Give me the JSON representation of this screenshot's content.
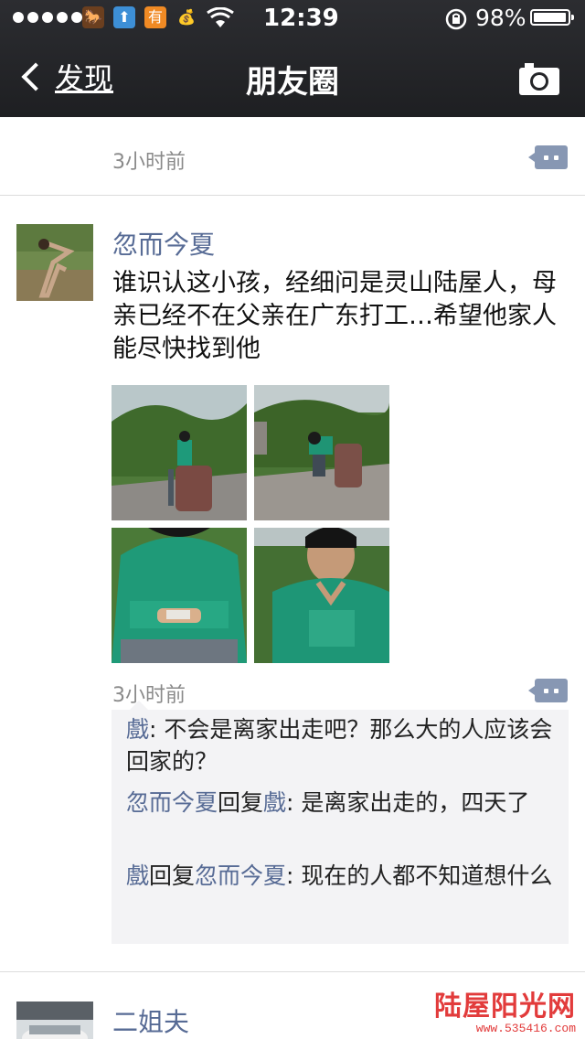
{
  "status_bar": {
    "time": "12:39",
    "battery": "98%",
    "battery_level": 0.98,
    "app_icon_2": "有"
  },
  "nav": {
    "back_label": "发现",
    "title": "朋友圈"
  },
  "feed": {
    "prev_post": {
      "timestamp": "3小时前"
    },
    "post": {
      "author": "忽而今夏",
      "text": "谁识认这小孩，经细问是灵山陆屋人，母亲已经不在父亲在广东打工…希望他家人能尽快找到他",
      "photos": [
        "boy-sitting-photo",
        "boy-crouching-photo",
        "boy-hands-closeup-photo",
        "boy-portrait-photo"
      ],
      "timestamp": "3小时前",
      "comments": [
        {
          "user": "戲",
          "reply_word": "",
          "reply_to": "",
          "text": ": 不会是离家出走吧？那么大的人应该会回家的？"
        },
        {
          "user": "忽而今夏",
          "reply_word": "回复",
          "reply_to": "戲",
          "text": ": 是离家出走的，四天了"
        },
        {
          "user": "戲",
          "reply_word": "回复",
          "reply_to": "忽而今夏",
          "text": ": 现在的人都不知道想什么"
        }
      ]
    },
    "next_post": {
      "author": "二姐夫"
    }
  },
  "watermark": {
    "title": "陆屋阳光网",
    "url": "www.535416.com"
  }
}
